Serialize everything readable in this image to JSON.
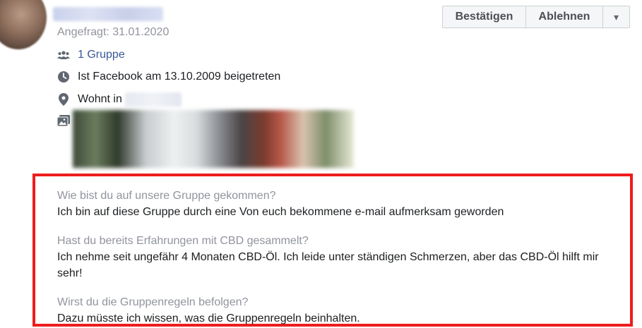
{
  "request": {
    "requested_label": "Angefragt: 31.01.2020",
    "groups_label": "1 Gruppe",
    "joined_label": "Ist Facebook am 13.10.2009 beigetreten",
    "lives_label": "Wohnt in"
  },
  "actions": {
    "confirm": "Bestätigen",
    "decline": "Ablehnen",
    "more_icon": "▾"
  },
  "questions": [
    {
      "q": "Wie bist du auf unsere Gruppe gekommen?",
      "a": "Ich bin auf diese Gruppe durch eine Von euch bekommene e-mail aufmerksam geworden"
    },
    {
      "q": "Hast du bereits Erfahrungen mit CBD gesammelt?",
      "a": "Ich nehme seit ungefähr 4 Monaten CBD-Öl. Ich leide unter ständigen Schmerzen, aber das CBD-Öl hilft mir sehr!"
    },
    {
      "q": "Wirst du die Gruppenregeln befolgen?",
      "a": "Dazu müsste ich wissen, was die Gruppenregeln beinhalten."
    }
  ],
  "colors": {
    "highlight_border": "#ee1d1d",
    "link": "#385898",
    "muted": "#90949c"
  }
}
